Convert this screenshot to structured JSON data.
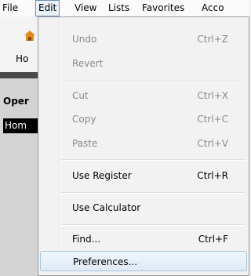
{
  "menubar": {
    "items": [
      "File",
      "Edit",
      "View",
      "Lists",
      "Favorites",
      "Acco"
    ]
  },
  "background": {
    "home_label": "Ho",
    "open_label": "Oper",
    "home_row": "Hom"
  },
  "edit_menu": {
    "undo": {
      "label": "Undo",
      "shortcut": "Ctrl+Z"
    },
    "revert": {
      "label": "Revert"
    },
    "cut": {
      "label": "Cut",
      "shortcut": "Ctrl+X"
    },
    "copy": {
      "label": "Copy",
      "shortcut": "Ctrl+C"
    },
    "paste": {
      "label": "Paste",
      "shortcut": "Ctrl+V"
    },
    "use_register": {
      "label": "Use Register",
      "shortcut": "Ctrl+R"
    },
    "use_calculator": {
      "label": "Use Calculator"
    },
    "find": {
      "label": "Find...",
      "shortcut": "Ctrl+F"
    },
    "preferences": {
      "label": "Preferences..."
    }
  }
}
